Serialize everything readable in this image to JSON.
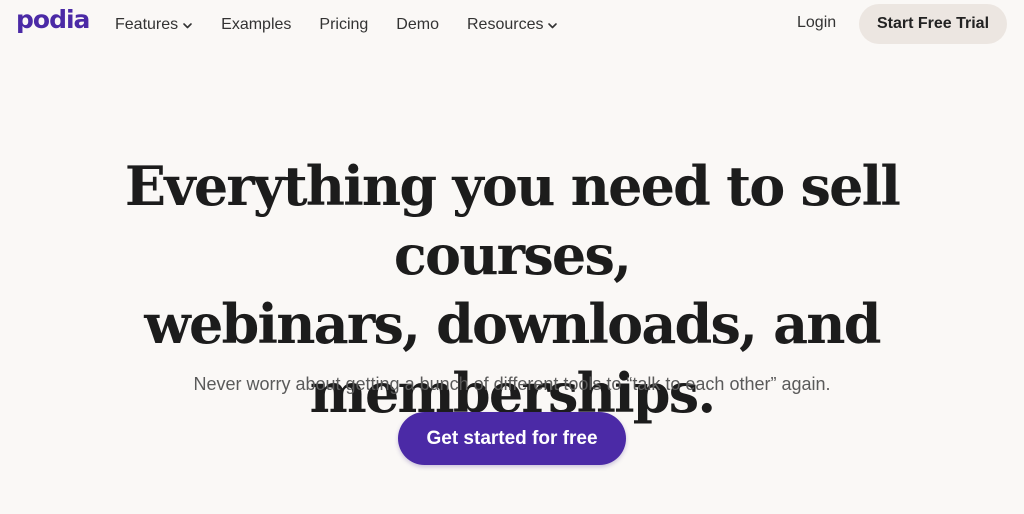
{
  "header": {
    "logo": "podia",
    "nav": [
      {
        "label": "Features",
        "dropdown": true
      },
      {
        "label": "Examples",
        "dropdown": false
      },
      {
        "label": "Pricing",
        "dropdown": false
      },
      {
        "label": "Demo",
        "dropdown": false
      },
      {
        "label": "Resources",
        "dropdown": true
      }
    ],
    "login": "Login",
    "trial_button": "Start Free Trial"
  },
  "hero": {
    "title_line1": "Everything you need to sell courses,",
    "title_line2": "webinars, downloads, and",
    "title_line3": "memberships.",
    "subtitle": "Never worry about getting a bunch of different tools to “talk to each other” again.",
    "cta": "Get started for free"
  },
  "colors": {
    "brand": "#4b2aa6",
    "background": "#faf8f6",
    "trial_button_bg": "#ece6e1"
  },
  "icons": {
    "dropdown": "chevron-down-icon"
  }
}
